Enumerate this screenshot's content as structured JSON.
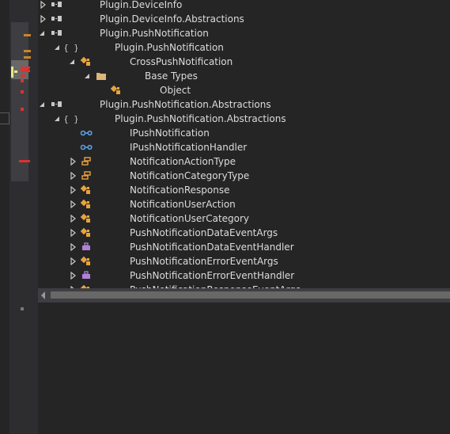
{
  "tree": {
    "rows": [
      {
        "label": "Plugin.DeviceInfo",
        "icon": "assembly-icon",
        "expander": "collapsed"
      },
      {
        "label": "Plugin.DeviceInfo.Abstractions",
        "icon": "assembly-icon",
        "expander": "collapsed"
      },
      {
        "label": "Plugin.PushNotification",
        "icon": "assembly-icon",
        "expander": "expanded"
      },
      {
        "label": "Plugin.PushNotification",
        "icon": "namespace-icon",
        "expander": "expanded"
      },
      {
        "label": "CrossPushNotification",
        "icon": "class-icon",
        "expander": "expanded"
      },
      {
        "label": "Base Types",
        "icon": "folder-icon",
        "expander": "expanded"
      },
      {
        "label": "Object",
        "icon": "class-icon",
        "expander": "none"
      },
      {
        "label": "Plugin.PushNotification.Abstractions",
        "icon": "assembly-icon",
        "expander": "expanded"
      },
      {
        "label": "Plugin.PushNotification.Abstractions",
        "icon": "namespace-icon",
        "expander": "expanded"
      },
      {
        "label": "IPushNotification",
        "icon": "interface-icon",
        "expander": "none"
      },
      {
        "label": "IPushNotificationHandler",
        "icon": "interface-icon",
        "expander": "none"
      },
      {
        "label": "NotificationActionType",
        "icon": "enum-icon",
        "expander": "collapsed"
      },
      {
        "label": "NotificationCategoryType",
        "icon": "enum-icon",
        "expander": "collapsed"
      },
      {
        "label": "NotificationResponse",
        "icon": "class-icon",
        "expander": "collapsed"
      },
      {
        "label": "NotificationUserAction",
        "icon": "class-icon",
        "expander": "collapsed"
      },
      {
        "label": "NotificationUserCategory",
        "icon": "class-icon",
        "expander": "collapsed"
      },
      {
        "label": "PushNotificationDataEventArgs",
        "icon": "class-icon",
        "expander": "collapsed"
      },
      {
        "label": "PushNotificationDataEventHandler",
        "icon": "delegate-icon",
        "expander": "collapsed"
      },
      {
        "label": "PushNotificationErrorEventArgs",
        "icon": "class-icon",
        "expander": "collapsed"
      },
      {
        "label": "PushNotificationErrorEventHandler",
        "icon": "delegate-icon",
        "expander": "collapsed"
      },
      {
        "label": "PushNotificationResponseEventArgs",
        "icon": "class-icon",
        "expander": "collapsed"
      }
    ]
  },
  "colors": {
    "background": "#252526",
    "text": "#dcdcdc",
    "class_icon": "#e8a33d",
    "interface_icon": "#5aa0e0",
    "enum_icon": "#e8a33d",
    "delegate_icon": "#b180d7",
    "folder_icon": "#dcb67a",
    "assembly_icon": "#c8c8c8"
  }
}
